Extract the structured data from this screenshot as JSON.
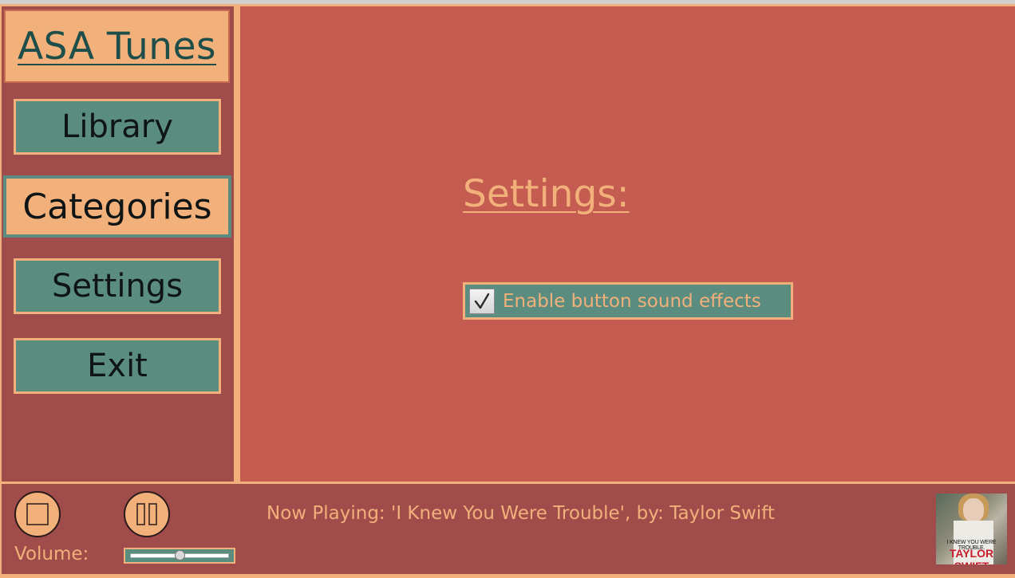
{
  "app": {
    "title": "ASA Tunes"
  },
  "sidebar": {
    "items": [
      {
        "label": "Library"
      },
      {
        "label": "Categories"
      },
      {
        "label": "Settings"
      },
      {
        "label": "Exit"
      }
    ]
  },
  "main": {
    "heading": "Settings:",
    "options": [
      {
        "label": "Enable button sound effects",
        "checked": true
      }
    ]
  },
  "player": {
    "now_playing": "Now Playing: 'I Knew You Were Trouble', by: Taylor Swift",
    "volume_label": "Volume:",
    "volume_level": 0.5,
    "album_art": {
      "text_top": "I KNEW YOU WERE TROUBLE.",
      "text_bottom": "TAYLOR SWIFT"
    }
  },
  "colors": {
    "peach": "#f2b07a",
    "sidebar_bg": "#9f4c4a",
    "main_bg": "#c45c52",
    "teal": "#5a8c7f"
  }
}
